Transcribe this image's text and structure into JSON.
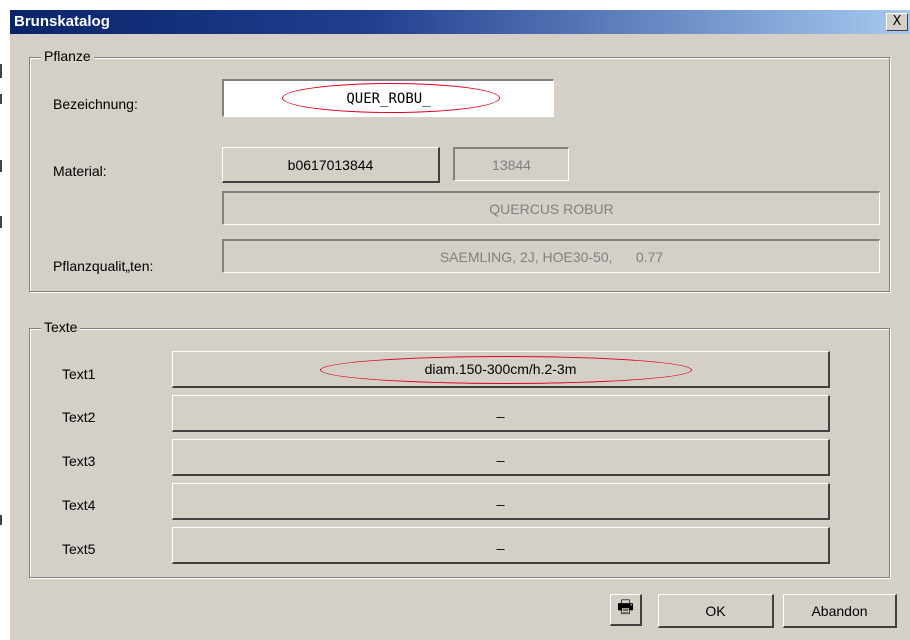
{
  "window": {
    "title": "Brunskatalog",
    "close_label": "X"
  },
  "pflanze": {
    "legend": "Pflanze",
    "bezeichnung_label": "Bezeichnung:",
    "bezeichnung_value": "QUER_ROBU_",
    "material_label": "Material:",
    "material_button": "b0617013844",
    "material_number": "13844",
    "material_name": "QUERCUS ROBUR",
    "qualitaeten_label": "Pflanzqualit„ten:",
    "qualitaeten_value": "SAEMLING, 2J, HOE30-50,      0.77"
  },
  "texte": {
    "legend": "Texte",
    "rows": [
      {
        "label": "Text1",
        "value": "diam.150-300cm/h.2-3m"
      },
      {
        "label": "Text2",
        "value": "_"
      },
      {
        "label": "Text3",
        "value": "_"
      },
      {
        "label": "Text4",
        "value": "_"
      },
      {
        "label": "Text5",
        "value": "_"
      }
    ]
  },
  "footer": {
    "print_icon": "printer-icon",
    "ok_label": "OK",
    "abandon_label": "Abandon"
  },
  "colors": {
    "window_bg": "#d4d0c8",
    "title_bar": "#0a246a",
    "highlight_ellipse": "#e0001a"
  }
}
